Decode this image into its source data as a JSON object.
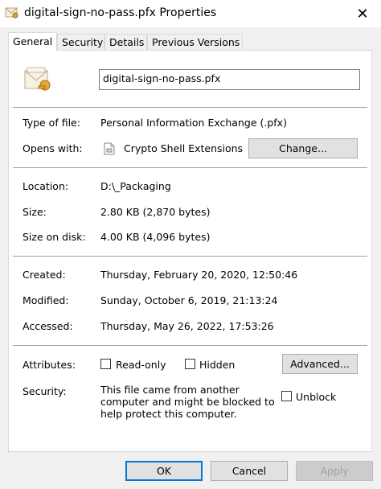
{
  "window": {
    "title": "digital-sign-no-pass.pfx Properties",
    "close_glyph": "✕"
  },
  "tabs": [
    "General",
    "Security",
    "Details",
    "Previous Versions"
  ],
  "general": {
    "filename": "digital-sign-no-pass.pfx",
    "type_label": "Type of file:",
    "type_value": "Personal Information Exchange (.pfx)",
    "opens_label": "Opens with:",
    "opens_value": "Crypto Shell Extensions",
    "change_button": "Change...",
    "location_label": "Location:",
    "location_value": "D:\\_Packaging",
    "size_label": "Size:",
    "size_value": "2.80 KB (2,870 bytes)",
    "size_disk_label": "Size on disk:",
    "size_disk_value": "4.00 KB (4,096 bytes)",
    "created_label": "Created:",
    "created_value": "Thursday, February 20, 2020, 12:50:46",
    "modified_label": "Modified:",
    "modified_value": "Sunday, October 6, 2019, 21:13:24",
    "accessed_label": "Accessed:",
    "accessed_value": "Thursday, May 26, 2022, 17:53:26",
    "attributes_label": "Attributes:",
    "readonly_label": "Read-only",
    "hidden_label": "Hidden",
    "advanced_button": "Advanced...",
    "security_label": "Security:",
    "security_text": "This file came from another computer and might be blocked to help protect this computer.",
    "unblock_label": "Unblock"
  },
  "buttons": {
    "ok": "OK",
    "cancel": "Cancel",
    "apply": "Apply"
  },
  "icons": {
    "title": "certificate-file-icon",
    "file": "certificate-file-icon",
    "app": "crypto-shell-icon"
  }
}
